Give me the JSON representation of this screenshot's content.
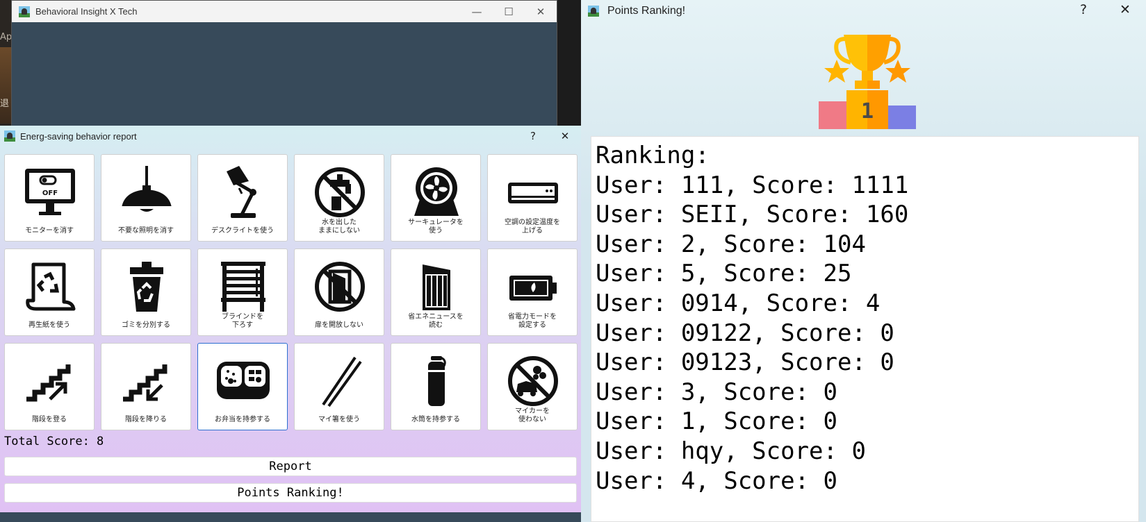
{
  "desktop": {
    "partial_text_1": "Ap",
    "partial_text_2": "退"
  },
  "main_window": {
    "title": "Behavioral Insight X Tech",
    "controls": {
      "minimize": "—",
      "maximize": "☐",
      "close": "✕"
    }
  },
  "report_dialog": {
    "title": "Energ-saving behavior report",
    "controls": {
      "help": "?",
      "close": "✕"
    },
    "tiles": [
      {
        "label": "モニターを消す",
        "icon": "monitor-off-icon"
      },
      {
        "label": "不要な照明を消す",
        "icon": "ceiling-lamp-icon"
      },
      {
        "label": "デスクライトを使う",
        "icon": "desk-lamp-icon"
      },
      {
        "label": "水を出した\nままにしない",
        "icon": "no-running-water-icon"
      },
      {
        "label": "サーキュレータを\n使う",
        "icon": "circulator-fan-icon"
      },
      {
        "label": "空調の設定温度を\n上げる",
        "icon": "air-conditioner-icon"
      },
      {
        "label": "再生紙を使う",
        "icon": "recycled-paper-icon"
      },
      {
        "label": "ゴミを分別する",
        "icon": "recycle-bin-icon"
      },
      {
        "label": "ブラインドを\n下ろす",
        "icon": "window-blind-icon"
      },
      {
        "label": "扉を開放しない",
        "icon": "no-open-door-icon"
      },
      {
        "label": "省エネニュースを\n読む",
        "icon": "newspaper-icon"
      },
      {
        "label": "省電力モードを\n設定する",
        "icon": "battery-saver-icon"
      },
      {
        "label": "階段を登る",
        "icon": "stairs-up-icon"
      },
      {
        "label": "階段を降りる",
        "icon": "stairs-down-icon"
      },
      {
        "label": "お弁当を持参する",
        "icon": "bento-box-icon",
        "selected": true
      },
      {
        "label": "マイ箸を使う",
        "icon": "chopsticks-icon"
      },
      {
        "label": "水筒を持参する",
        "icon": "water-bottle-icon"
      },
      {
        "label": "マイカーを\n使わない",
        "icon": "no-car-icon"
      }
    ],
    "total_score": "Total Score: 8",
    "report_button": "Report",
    "ranking_button": "Points Ranking!"
  },
  "ranking_window": {
    "title": "Points Ranking!",
    "controls": {
      "help": "?",
      "close": "✕"
    },
    "trophy_icon": "trophy-podium-icon",
    "podium_number": "1",
    "heading": "Ranking:",
    "entries": [
      "User: 111, Score: 1111",
      "User: SEII, Score: 160",
      "User: 2, Score: 104",
      "User: 5, Score: 25",
      "User: 0914, Score: 4",
      "User: 09122, Score: 0",
      "User: 09123, Score: 0",
      "User: 3, Score: 0",
      "User: 1, Score: 0",
      "User: hqy, Score: 0",
      "User: 4, Score: 0"
    ]
  }
}
